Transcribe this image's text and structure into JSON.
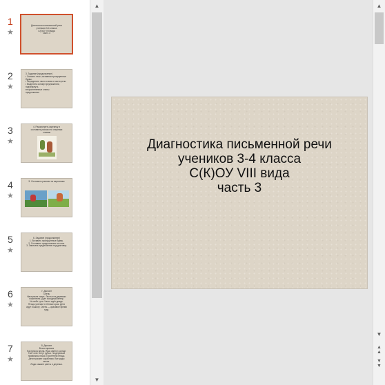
{
  "thumbnails": [
    {
      "number": "1",
      "star_icon": "star-icon",
      "selected": true,
      "text": "Диагностика письменной речи\nучеников 3-4 класса\nС(К)ОУ VIII вида\nчасть 3"
    },
    {
      "number": "2",
      "star_icon": "star-icon",
      "selected": false,
      "text": "3. Задание (продолжение)\n• Списать текст, вставляя пропущенные буквы.\n• Определить части слова и части речи.\n• Выделить основу предложения, подчеркнуть\n  второстепенные члены\n  предложения"
    },
    {
      "number": "3",
      "star_icon": "star-icon",
      "selected": false,
      "text": "4. Рассмотреть картинку и\nсоставить рассказ по опорным\nсловам"
    },
    {
      "number": "4",
      "star_icon": "star-icon",
      "selected": false,
      "text": "5. Составить рассказ по картинкам"
    },
    {
      "number": "5",
      "star_icon": "star-icon",
      "selected": false,
      "text": "6. Задание (продолжение)\n1. Вставить пропущенные буквы.\n2. Составить предложения из слов.\n3. Записать предложения под диктовку."
    },
    {
      "number": "6",
      "star_icon": "star-icon",
      "selected": false,
      "text": "7. Диктант\nОсень\nНаступила осень. Листья на деревьях\nпожелтели. Дует холодный ветер.\nНа небе тучи. Часто идёт дождь.\nПтицы улетают в тёплые края. Дети\nидут в школу. Осень — красивое время года."
    },
    {
      "number": "7",
      "star_icon": "star-icon",
      "selected": false,
      "text": "8. Диктант\nВесна пришла\nНаступила весна. Ярко светит солнце.\nТает снег. Бегут ручьи. На деревьях\nпоявились почки. Прилетели птицы.\nДети пускают кораблики. Все рады весне.\nЛюди сажают цветы и деревья."
    }
  ],
  "slide": {
    "title_lines": [
      "Диагностика письменной  речи",
      "учеников 3-4 класса",
      "С(К)ОУ VIII вида",
      "часть 3"
    ]
  },
  "scrollbars": {
    "up_arrow_icon": "triangle-up-icon",
    "down_arrow_icon": "triangle-down-icon",
    "prev_slide_icon": "double-up-icon",
    "next_slide_icon": "double-down-icon"
  },
  "colors": {
    "slide_bg": "#ddd5c7",
    "selection": "#d0502c",
    "active_number": "#c43e1c"
  }
}
